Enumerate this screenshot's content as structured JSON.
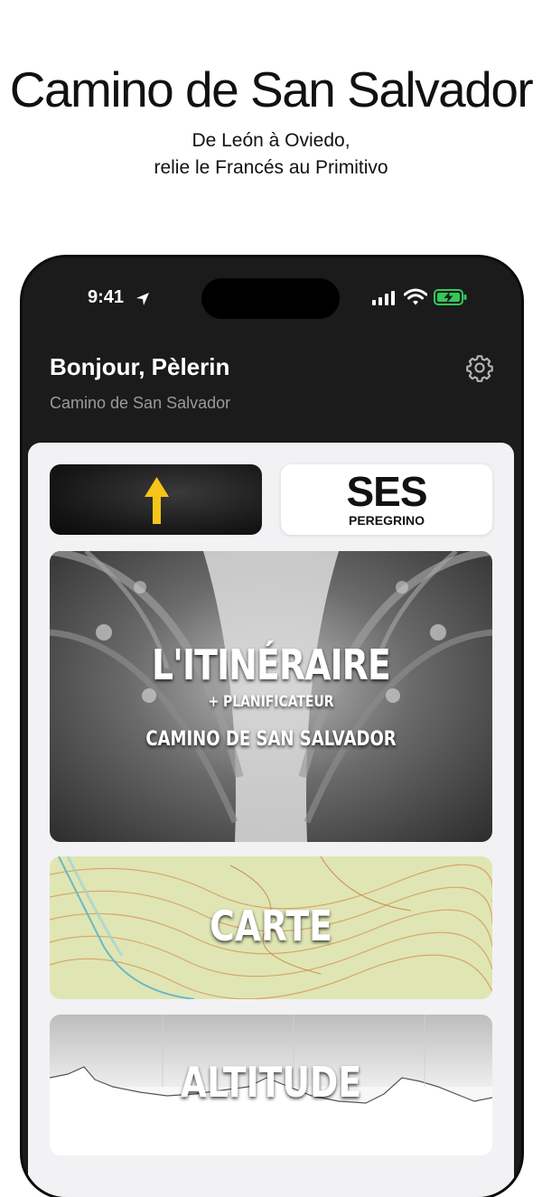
{
  "promo": {
    "title": "Camino de San Salvador",
    "subtitle_line1": "De León à Oviedo,",
    "subtitle_line2": "relie le Francés au Primitivo"
  },
  "status_bar": {
    "time": "9:41",
    "icons": [
      "location-arrow-icon",
      "signal-icon",
      "wifi-icon",
      "battery-charging-icon"
    ]
  },
  "header": {
    "greeting": "Bonjour, Pèlerin",
    "subtitle": "Camino de San Salvador",
    "settings_icon": "gear-icon"
  },
  "tiles": {
    "arrow": {
      "icon": "yellow-arrow-icon",
      "color": "#f5c518"
    },
    "ses": {
      "logo": "SES",
      "caption": "PEREGRINO"
    },
    "itinerary": {
      "title": "L'ITINÉRAIRE",
      "subtitle": "+ PLANIFICATEUR",
      "caption": "CAMINO DE SAN SALVADOR"
    },
    "map": {
      "title": "CARTE"
    },
    "altitude": {
      "title": "ALTITUDE"
    }
  },
  "colors": {
    "app_background": "#1b1b1b",
    "content_background": "#f2f2f4",
    "accent_yellow": "#f5c518",
    "battery_green": "#34c759"
  }
}
